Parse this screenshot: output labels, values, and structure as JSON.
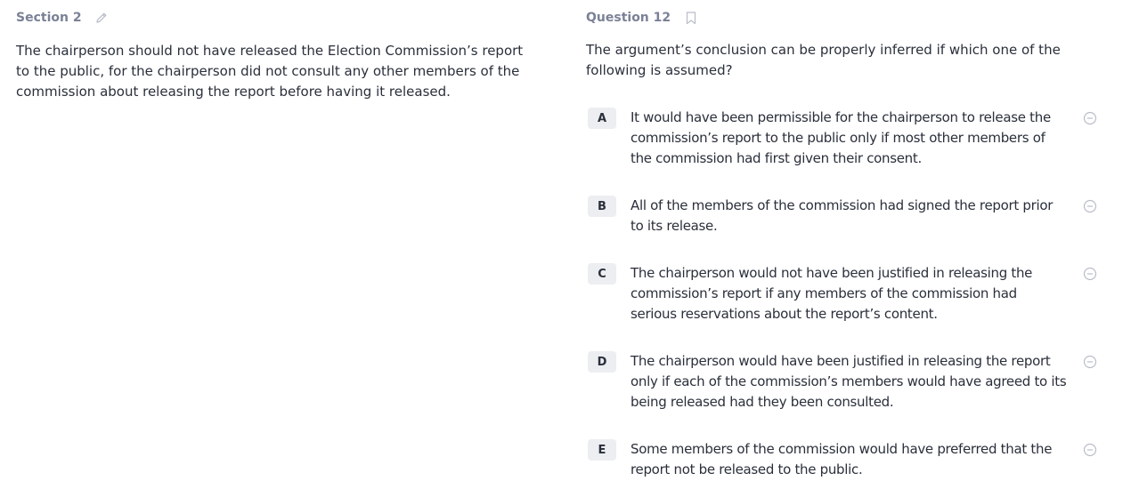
{
  "left": {
    "section_label": "Section 2",
    "edit_icon": "pencil-icon",
    "passage": "The chairperson should not have released the Election Commission’s report to the public, for the chairperson did not consult any other members of the commission about releasing the report before having it released."
  },
  "right": {
    "question_label": "Question 12",
    "bookmark_icon": "bookmark-icon",
    "stem": "The argument’s conclusion can be properly inferred if which one of the following is assumed?",
    "choices": [
      {
        "letter": "A",
        "text": "It would have been permissible for the chairperson to release the commission’s report to the public only if most other members of the commission had first given their consent."
      },
      {
        "letter": "B",
        "text": "All of the members of the commission had signed the report prior to its release."
      },
      {
        "letter": "C",
        "text": "The chairperson would not have been justified in releasing the commission’s report if any members of the commission had serious reservations about the report’s content."
      },
      {
        "letter": "D",
        "text": "The chairperson would have been justified in releasing the report only if each of the commission’s members would have agreed to its being released had they been consulted."
      },
      {
        "letter": "E",
        "text": "Some members of the commission would have preferred that the report not be released to the public."
      }
    ],
    "strike_icon": "strikethrough-circle-icon"
  },
  "colors": {
    "header": "#7b8196",
    "text": "#2a2f3a",
    "letter_bg": "#eceef2",
    "icon": "#b9bdc8"
  }
}
